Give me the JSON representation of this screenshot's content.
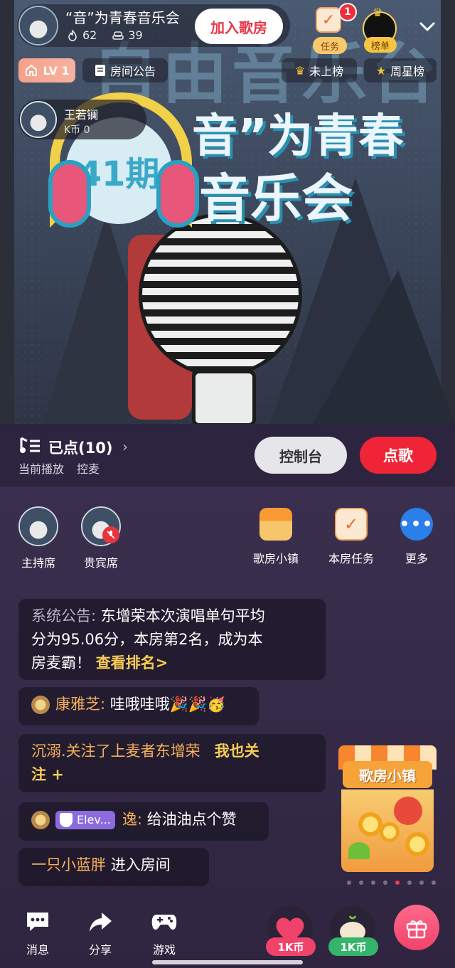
{
  "room": {
    "title": "“音”为青春音乐会",
    "listeners": "62",
    "members": "39",
    "join_label": "加入歌房",
    "task_label": "任务",
    "task_badge": "1",
    "rank_label": "榜单",
    "level": "LV 1",
    "notice_label": "房间公告",
    "not_ranked_label": "未上榜",
    "week_star_label": "周星榜"
  },
  "poster": {
    "bg_text": "自由音乐台",
    "issue": "41期",
    "title_line1": "音”为青春",
    "title_line2": "音乐会"
  },
  "singer": {
    "name": "王若镧",
    "coins": "K币 0"
  },
  "control": {
    "queue_label": "已点(10)",
    "now_playing": "当前播放",
    "mic_control": "控麦",
    "console_label": "控制台",
    "order_label": "点歌"
  },
  "seats": [
    {
      "label": "主持席"
    },
    {
      "label": "贵宾席"
    }
  ],
  "actions": {
    "shop": "歌房小镇",
    "tasks": "本房任务",
    "more": "更多"
  },
  "chat": {
    "system_label": "系统公告:",
    "system_text_1": "东增荣本次演唱单句平均",
    "system_text_2": "分为95.06分，本房第2名，成为本",
    "system_text_3": "房麦霸！",
    "system_link": "查看排名>",
    "msg1_name": "康雅芝:",
    "msg1_text": "哇哦哇哦🎉🎉🥳",
    "msg2_text": "沉溺.关注了上麦者东增荣",
    "msg2_follow_1": "我也关",
    "msg2_follow_2": "注 +",
    "msg3_tag": "Elev...",
    "msg3_name": "逸:",
    "msg3_text": "给油油点个赞",
    "msg4_name": "一只小蓝胖",
    "msg4_text": "进入房间"
  },
  "promo": {
    "title": "歌房小镇"
  },
  "bottom": {
    "message": "消息",
    "share": "分享",
    "game": "游戏",
    "gift1_price": "1K币",
    "gift2_price": "1K币"
  },
  "colors": {
    "primary_red": "#ef2436",
    "gold": "#f7cc54",
    "panel_bg": "#2f2540"
  }
}
